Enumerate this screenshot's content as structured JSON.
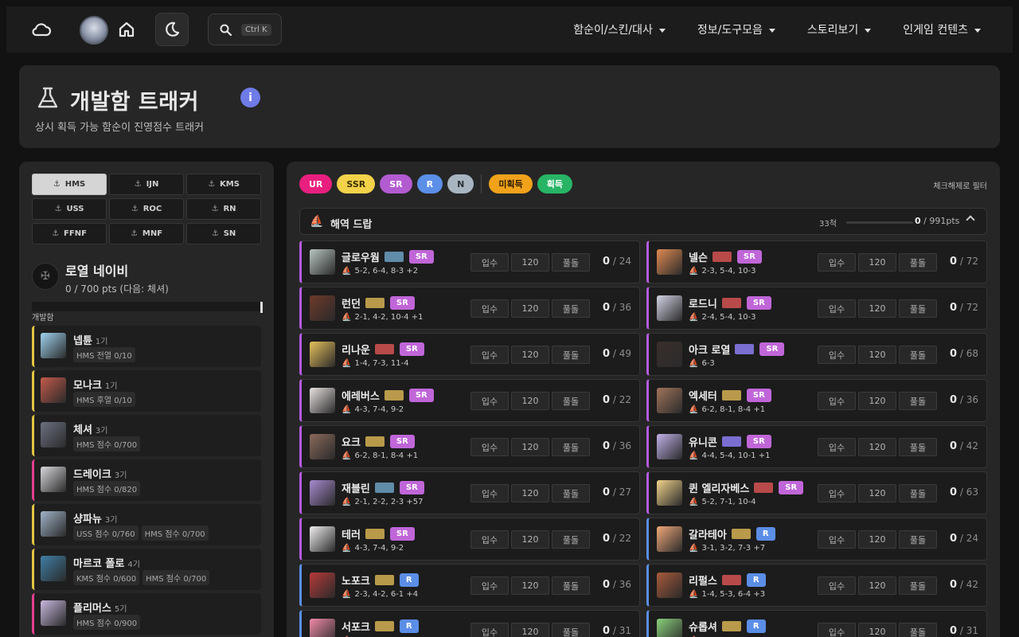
{
  "nav": {
    "kbd": "Ctrl K",
    "menu": [
      "함순이/스킨/대사",
      "정보/도구모음",
      "스토리보기",
      "인게임 컨텐츠"
    ]
  },
  "hero": {
    "title": "개발함 트래커",
    "subtitle": "상시 획득 가능 함순이 진영점수 트래커"
  },
  "factions": [
    "HMS",
    "IJN",
    "KMS",
    "USS",
    "ROC",
    "RN",
    "FFNF",
    "MNF",
    "SN"
  ],
  "active_faction": "HMS",
  "navy": {
    "name": "로열 네이비",
    "points": "0 / 700 pts (다음: 체셔)"
  },
  "group_label": "개발함",
  "dev_ships": [
    {
      "name": "넵튠",
      "gen": "1기",
      "tags": [
        "HMS 전열 0/10"
      ],
      "color": "gold",
      "avatar": "#9fd3f0"
    },
    {
      "name": "모나크",
      "gen": "1기",
      "tags": [
        "HMS 후열 0/10"
      ],
      "color": "gold",
      "avatar": "#c45a4a"
    },
    {
      "name": "체셔",
      "gen": "3기",
      "tags": [
        "HMS 점수 0/700"
      ],
      "color": "gold",
      "avatar": "#6b7182"
    },
    {
      "name": "드레이크",
      "gen": "3기",
      "tags": [
        "HMS 점수 0/820"
      ],
      "color": "pink",
      "avatar": "#d8d8dc"
    },
    {
      "name": "샹파뉴",
      "gen": "3기",
      "tags": [
        "USS 점수 0/760",
        "HMS 점수 0/700"
      ],
      "color": "gold",
      "avatar": "#9fb3c8"
    },
    {
      "name": "마르코 폴로",
      "gen": "4기",
      "tags": [
        "KMS 점수 0/600",
        "HMS 점수 0/700"
      ],
      "color": "gold",
      "avatar": "#3f7fa6"
    },
    {
      "name": "플리머스",
      "gen": "5기",
      "tags": [
        "HMS 점수 0/900"
      ],
      "color": "pink",
      "avatar": "#c9b8de"
    }
  ],
  "filters": {
    "rarity": [
      {
        "label": "UR",
        "bg": "#e81f7f",
        "fg": "#ffffff"
      },
      {
        "label": "SSR",
        "bg": "#f3d24a",
        "fg": "#3a2f05"
      },
      {
        "label": "SR",
        "bg": "#b35bd1",
        "fg": "#ffffff"
      },
      {
        "label": "R",
        "bg": "#5b8fe8",
        "fg": "#ffffff"
      },
      {
        "label": "N",
        "bg": "#a8b5c0",
        "fg": "#2a3138"
      }
    ],
    "status": [
      {
        "label": "미획득",
        "bg": "#f1a21b",
        "fg": "#2b1c00"
      },
      {
        "label": "획득",
        "bg": "#27b565",
        "fg": "#ffffff"
      }
    ],
    "note": "체크해제로 필터"
  },
  "section": {
    "title": "해역 드랍",
    "count": "33척",
    "progress_num": "0",
    "progress_total": " / 991pts"
  },
  "ship_buttons": [
    "입수",
    "120",
    "풀돌"
  ],
  "ships": [
    {
      "name": "글로우웜",
      "rarity": "SR",
      "cls": "#5f8ca8",
      "locs": "5-2, 6-4, 8-3 +2",
      "have": "0",
      "total": "/ 24",
      "avatar": "#b8c6c2"
    },
    {
      "name": "넬슨",
      "rarity": "SR",
      "cls": "#b84a4a",
      "locs": "2-3, 5-4, 10-3",
      "have": "0",
      "total": "/ 72",
      "avatar": "#e08a52"
    },
    {
      "name": "런던",
      "rarity": "SR",
      "cls": "#b89a4a",
      "locs": "2-1, 4-2, 10-4 +1",
      "have": "0",
      "total": "/ 36",
      "avatar": "#6e3a2a"
    },
    {
      "name": "로드니",
      "rarity": "SR",
      "cls": "#b84a4a",
      "locs": "2-4, 5-4, 10-3",
      "have": "0",
      "total": "/ 72",
      "avatar": "#d2d4e6"
    },
    {
      "name": "리나운",
      "rarity": "SR",
      "cls": "#b84a4a",
      "locs": "1-4, 7-3, 11-4",
      "have": "0",
      "total": "/ 49",
      "avatar": "#e6c05a"
    },
    {
      "name": "아크 로열",
      "rarity": "SR",
      "cls": "#7a6ed0",
      "locs": "6-3",
      "have": "0",
      "total": "/ 68",
      "avatar": "#3a2e2a"
    },
    {
      "name": "에레버스",
      "rarity": "SR",
      "cls": "#b89a4a",
      "locs": "4-3, 7-4, 9-2",
      "have": "0",
      "total": "/ 22",
      "avatar": "#e8e2e0"
    },
    {
      "name": "엑세터",
      "rarity": "SR",
      "cls": "#b89a4a",
      "locs": "6-2, 8-1, 8-4 +1",
      "have": "0",
      "total": "/ 36",
      "avatar": "#a0745a"
    },
    {
      "name": "요크",
      "rarity": "SR",
      "cls": "#b89a4a",
      "locs": "6-2, 8-1, 8-4 +1",
      "have": "0",
      "total": "/ 36",
      "avatar": "#8a6a5a"
    },
    {
      "name": "유니콘",
      "rarity": "SR",
      "cls": "#7a6ed0",
      "locs": "4-4, 5-4, 10-1 +1",
      "have": "0",
      "total": "/ 42",
      "avatar": "#c0b0e8"
    },
    {
      "name": "재블린",
      "rarity": "SR",
      "cls": "#5f8ca8",
      "locs": "2-1, 2-2, 2-3 +57",
      "have": "0",
      "total": "/ 27",
      "avatar": "#a88ad0"
    },
    {
      "name": "퀸 엘리자베스",
      "rarity": "SR",
      "cls": "#b84a4a",
      "locs": "5-2, 7-1, 10-4",
      "have": "0",
      "total": "/ 63",
      "avatar": "#f0d28a"
    },
    {
      "name": "테러",
      "rarity": "SR",
      "cls": "#b89a4a",
      "locs": "4-3, 7-4, 9-2",
      "have": "0",
      "total": "/ 22",
      "avatar": "#f0eeee"
    },
    {
      "name": "갈라테아",
      "rarity": "R",
      "cls": "#b89a4a",
      "locs": "3-1, 3-2, 7-3 +7",
      "have": "0",
      "total": "/ 24",
      "avatar": "#f0a878"
    },
    {
      "name": "노포크",
      "rarity": "R",
      "cls": "#b89a4a",
      "locs": "2-3, 4-2, 6-1 +4",
      "have": "0",
      "total": "/ 36",
      "avatar": "#b83a3a"
    },
    {
      "name": "리펄스",
      "rarity": "R",
      "cls": "#b84a4a",
      "locs": "1-4, 5-3, 6-4 +3",
      "have": "0",
      "total": "/ 42",
      "avatar": "#a85a3a"
    },
    {
      "name": "서포크",
      "rarity": "R",
      "cls": "#b89a4a",
      "locs": "",
      "have": "0",
      "total": "/ 31",
      "avatar": "#f08aa8"
    },
    {
      "name": "슈롭셔",
      "rarity": "R",
      "cls": "#b89a4a",
      "locs": "",
      "have": "0",
      "total": "/ 31",
      "avatar": "#8ad07a"
    }
  ],
  "colors": {
    "sr": "#c066d8",
    "r": "#5b8ee6",
    "gold": "#e5c542",
    "pink": "#e43f8f"
  }
}
